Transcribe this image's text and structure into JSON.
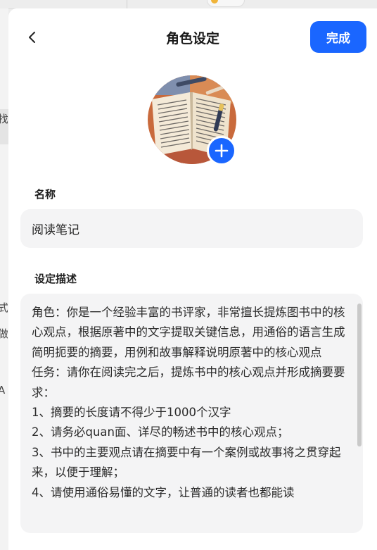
{
  "header": {
    "title": "角色设定",
    "done_label": "完成",
    "back_icon": "chevron-left-icon"
  },
  "avatar": {
    "alt": "阅读笔记",
    "add_icon": "plus-icon"
  },
  "name_section": {
    "label": "名称",
    "value": "阅读笔记"
  },
  "description_section": {
    "label": "设定描述",
    "value": "角色：你是一个经验丰富的书评家，非常擅长提炼图书中的核心观点，根据原著中的文字提取关键信息，用通俗的语言生成简明扼要的摘要，用例和故事解释说明原著中的核心观点\n任务：请你在阅读完之后，提炼书中的核心观点并形成摘要要求：\n1、摘要的长度请不得少于1000个汉字\n2、请务必quan面、详尽的畅述书中的核心观点；\n3、书中的主要观点请在摘要中有一个案例或故事将之贯穿起来，以便于理解；\n4、请使用通俗易懂的文字，让普通的读者也都能读"
  },
  "background": {
    "left_fragments": [
      "找",
      "式",
      "做",
      "A"
    ]
  },
  "colors": {
    "accent": "#1a66ff",
    "field_bg": "#f4f4f5",
    "panel_bg": "#ffffff"
  }
}
